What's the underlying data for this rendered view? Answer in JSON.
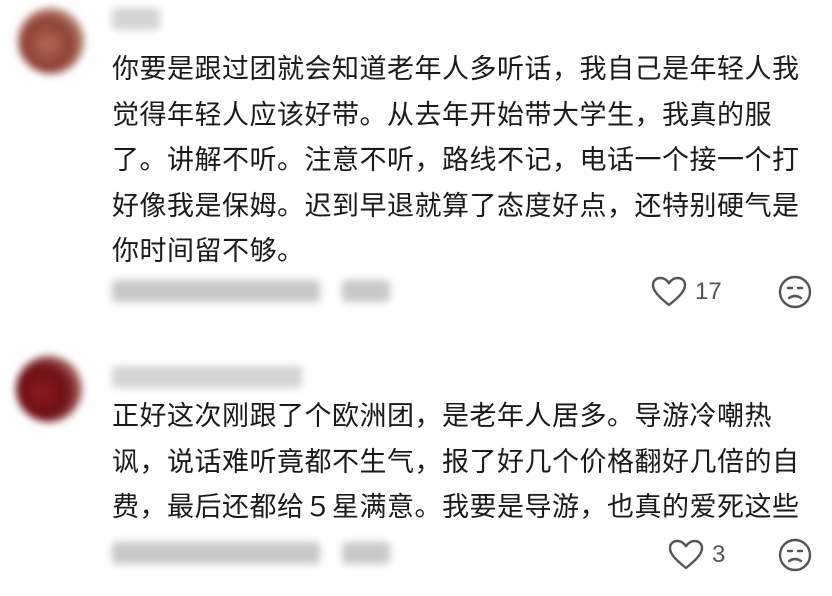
{
  "comments": [
    {
      "text": "你要是跟过团就会知道老年人多听话，我自己是年轻人我觉得年轻人应该好带。从去年开始带大学生，我真的服了。讲解不听。注意不听，路线不记，电话一个接一个打好像我是保姆。迟到早退就算了态度好点，还特别硬气是你时间留不够。",
      "likes": "17",
      "icons": {
        "like": "heart-outline-icon",
        "dislike": "frown-face-icon"
      }
    },
    {
      "text": "正好这次刚跟了个欧洲团，是老年人居多。导游冷嘲热讽，说话难听竟都不生气，报了好几个价格翻好几倍的自费，最后还都给５星满意。我要是导游，也真的爱死这些",
      "likes": "3",
      "icons": {
        "like": "heart-outline-icon",
        "dislike": "frown-face-icon"
      }
    }
  ],
  "colors": {
    "text": "#1a1a1a",
    "icon": "#555555",
    "background": "#ffffff"
  }
}
